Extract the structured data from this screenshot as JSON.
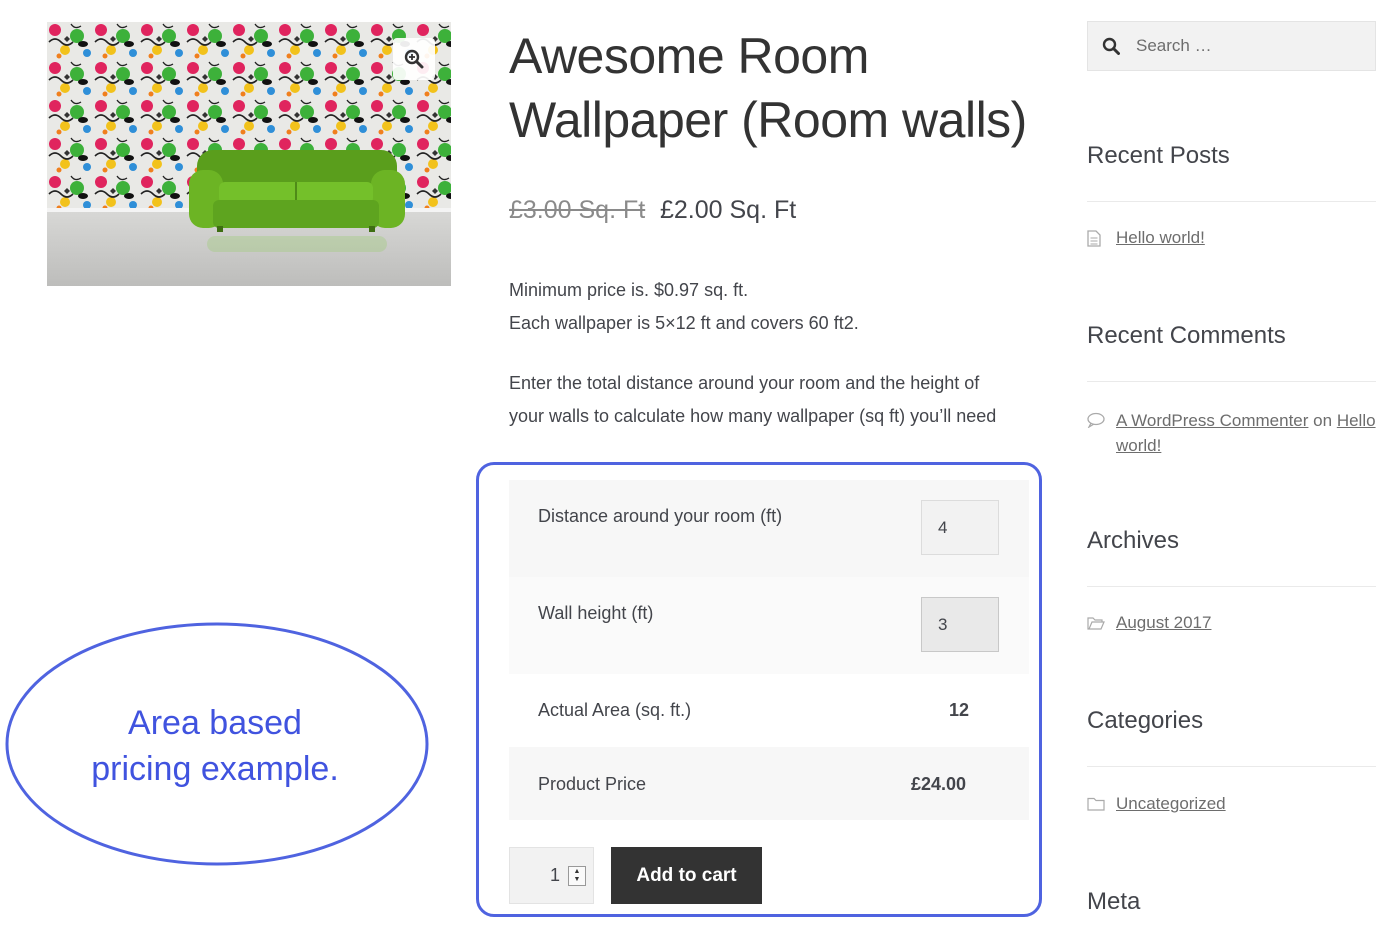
{
  "product": {
    "title_line1": "Awesome Room",
    "title_line2": "Wallpaper (Room walls)",
    "price_old": "£3.00 Sq. Ft",
    "price_new": "£2.00 Sq. Ft",
    "description": [
      "Minimum price is. $0.97 sq. ft.",
      "Each wallpaper is 5×12 ft and covers 60 ft2.",
      "Enter the total distance around your room and the height of",
      "your walls to calculate how many wallpaper (sq ft) you’ll need"
    ]
  },
  "calculator": {
    "distance_label": "Distance around your room (ft)",
    "distance_value": "4",
    "height_label": "Wall height (ft)",
    "height_value": "3",
    "area_label": "Actual Area (sq. ft.)",
    "area_value": "12",
    "price_label": "Product Price",
    "price_value": "£24.00"
  },
  "cart": {
    "quantity": "1",
    "add_to_cart_label": "Add to cart"
  },
  "annotation": {
    "line1": "Area based",
    "line2": "pricing example.",
    "color": "#4f63e0"
  },
  "sidebar": {
    "search_placeholder": "Search …",
    "recent_posts_title": "Recent Posts",
    "recent_post_1": "Hello world!",
    "recent_comments_title": "Recent Comments",
    "comment_author": "A WordPress Commenter",
    "comment_on": "on",
    "comment_post_1": "Hello",
    "comment_post_2": "world!",
    "archives_title": "Archives",
    "archive_1": "August 2017",
    "categories_title": "Categories",
    "category_1": "Uncategorized",
    "meta_title": "Meta"
  }
}
